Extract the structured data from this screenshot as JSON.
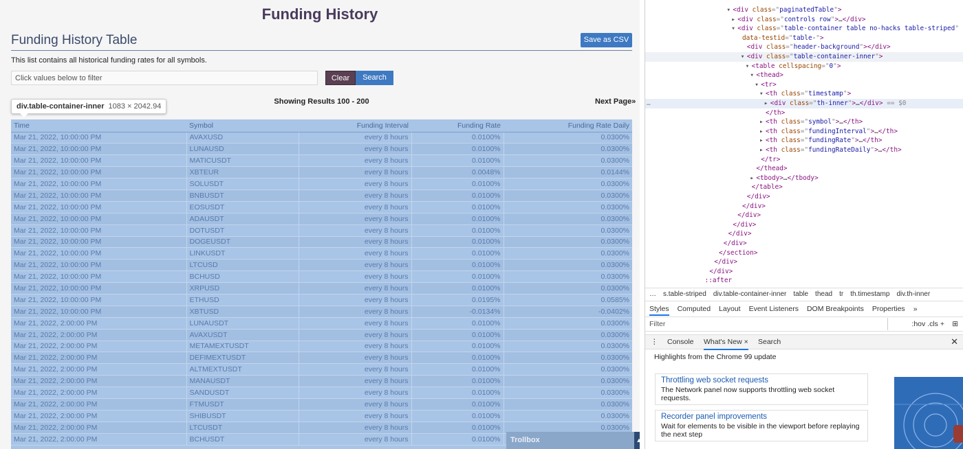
{
  "page": {
    "title": "Funding History",
    "table_heading": "Funding History Table",
    "save_csv": "Save as CSV",
    "description": "This list contains all historical funding rates for all symbols.",
    "filter_placeholder": "Click values below to filter",
    "clear": "Clear",
    "search": "Search",
    "showing": "Showing Results 100 - 200",
    "next_page": "Next Page»",
    "trollbox": "Trollbox"
  },
  "tooltip": {
    "selector": "div.table-container-inner",
    "dims": "1083 × 2042.94"
  },
  "table": {
    "headers": [
      "Time",
      "Symbol",
      "Funding Interval",
      "Funding Rate",
      "Funding Rate Daily"
    ],
    "rows": [
      [
        "Mar 21, 2022, 10:00:00 PM",
        "AVAXUSD",
        "every 8 hours",
        "0.0100%",
        "0.0300%"
      ],
      [
        "Mar 21, 2022, 10:00:00 PM",
        "LUNAUSD",
        "every 8 hours",
        "0.0100%",
        "0.0300%"
      ],
      [
        "Mar 21, 2022, 10:00:00 PM",
        "MATICUSDT",
        "every 8 hours",
        "0.0100%",
        "0.0300%"
      ],
      [
        "Mar 21, 2022, 10:00:00 PM",
        "XBTEUR",
        "every 8 hours",
        "0.0048%",
        "0.0144%"
      ],
      [
        "Mar 21, 2022, 10:00:00 PM",
        "SOLUSDT",
        "every 8 hours",
        "0.0100%",
        "0.0300%"
      ],
      [
        "Mar 21, 2022, 10:00:00 PM",
        "BNBUSDT",
        "every 8 hours",
        "0.0100%",
        "0.0300%"
      ],
      [
        "Mar 21, 2022, 10:00:00 PM",
        "EOSUSDT",
        "every 8 hours",
        "0.0100%",
        "0.0300%"
      ],
      [
        "Mar 21, 2022, 10:00:00 PM",
        "ADAUSDT",
        "every 8 hours",
        "0.0100%",
        "0.0300%"
      ],
      [
        "Mar 21, 2022, 10:00:00 PM",
        "DOTUSDT",
        "every 8 hours",
        "0.0100%",
        "0.0300%"
      ],
      [
        "Mar 21, 2022, 10:00:00 PM",
        "DOGEUSDT",
        "every 8 hours",
        "0.0100%",
        "0.0300%"
      ],
      [
        "Mar 21, 2022, 10:00:00 PM",
        "LINKUSDT",
        "every 8 hours",
        "0.0100%",
        "0.0300%"
      ],
      [
        "Mar 21, 2022, 10:00:00 PM",
        "LTCUSD",
        "every 8 hours",
        "0.0100%",
        "0.0300%"
      ],
      [
        "Mar 21, 2022, 10:00:00 PM",
        "BCHUSD",
        "every 8 hours",
        "0.0100%",
        "0.0300%"
      ],
      [
        "Mar 21, 2022, 10:00:00 PM",
        "XRPUSD",
        "every 8 hours",
        "0.0100%",
        "0.0300%"
      ],
      [
        "Mar 21, 2022, 10:00:00 PM",
        "ETHUSD",
        "every 8 hours",
        "0.0195%",
        "0.0585%"
      ],
      [
        "Mar 21, 2022, 10:00:00 PM",
        "XBTUSD",
        "every 8 hours",
        "-0.0134%",
        "-0.0402%"
      ],
      [
        "Mar 21, 2022, 2:00:00 PM",
        "LUNAUSDT",
        "every 8 hours",
        "0.0100%",
        "0.0300%"
      ],
      [
        "Mar 21, 2022, 2:00:00 PM",
        "AVAXUSDT",
        "every 8 hours",
        "0.0100%",
        "0.0300%"
      ],
      [
        "Mar 21, 2022, 2:00:00 PM",
        "METAMEXTUSDT",
        "every 8 hours",
        "0.0100%",
        "0.0300%"
      ],
      [
        "Mar 21, 2022, 2:00:00 PM",
        "DEFIMEXTUSDT",
        "every 8 hours",
        "0.0100%",
        "0.0300%"
      ],
      [
        "Mar 21, 2022, 2:00:00 PM",
        "ALTMEXTUSDT",
        "every 8 hours",
        "0.0100%",
        "0.0300%"
      ],
      [
        "Mar 21, 2022, 2:00:00 PM",
        "MANAUSDT",
        "every 8 hours",
        "0.0100%",
        "0.0300%"
      ],
      [
        "Mar 21, 2022, 2:00:00 PM",
        "SANDUSDT",
        "every 8 hours",
        "0.0100%",
        "0.0300%"
      ],
      [
        "Mar 21, 2022, 2:00:00 PM",
        "FTMUSDT",
        "every 8 hours",
        "0.0100%",
        "0.0300%"
      ],
      [
        "Mar 21, 2022, 2:00:00 PM",
        "SHIBUSDT",
        "every 8 hours",
        "0.0100%",
        "0.0300%"
      ],
      [
        "Mar 21, 2022, 2:00:00 PM",
        "LTCUSDT",
        "every 8 hours",
        "0.0100%",
        "0.0300%"
      ],
      [
        "Mar 21, 2022, 2:00:00 PM",
        "BCHUSDT",
        "every 8 hours",
        "0.0100%",
        "0.0300%"
      ]
    ]
  },
  "devtools": {
    "dom_lines": [
      {
        "indent": 18,
        "arrow": "▾",
        "parts": [
          [
            "tg",
            "<div "
          ],
          [
            "at",
            "class"
          ],
          [
            "eq",
            "=\""
          ],
          [
            "av",
            "paginatedTable"
          ],
          [
            "eq",
            "\""
          ],
          [
            "tg",
            ">"
          ]
        ]
      },
      {
        "indent": 19,
        "arrow": "▸",
        "parts": [
          [
            "tg",
            "<div "
          ],
          [
            "at",
            "class"
          ],
          [
            "eq",
            "=\""
          ],
          [
            "av",
            "controls row"
          ],
          [
            "eq",
            "\""
          ],
          [
            "tg",
            ">"
          ],
          [
            "tx",
            "…"
          ],
          [
            "tg",
            "</div>"
          ]
        ]
      },
      {
        "indent": 19,
        "arrow": "▾",
        "parts": [
          [
            "tg",
            "<div "
          ],
          [
            "at",
            "class"
          ],
          [
            "eq",
            "=\""
          ],
          [
            "av",
            "table-container table no-hacks table-striped"
          ],
          [
            "eq",
            "\""
          ]
        ]
      },
      {
        "indent": 20,
        "arrow": "",
        "parts": [
          [
            "at",
            "data-testid"
          ],
          [
            "eq",
            "=\""
          ],
          [
            "av",
            "table-"
          ],
          [
            "eq",
            "\""
          ],
          [
            "tg",
            ">"
          ]
        ]
      },
      {
        "indent": 21,
        "arrow": "",
        "parts": [
          [
            "tg",
            "<div "
          ],
          [
            "at",
            "class"
          ],
          [
            "eq",
            "=\""
          ],
          [
            "av",
            "header-background"
          ],
          [
            "eq",
            "\""
          ],
          [
            "tg",
            "></div>"
          ]
        ]
      },
      {
        "indent": 21,
        "arrow": "▾",
        "hov": true,
        "parts": [
          [
            "tg",
            "<div "
          ],
          [
            "at",
            "class"
          ],
          [
            "eq",
            "=\""
          ],
          [
            "av",
            "table-container-inner"
          ],
          [
            "eq",
            "\""
          ],
          [
            "tg",
            ">"
          ]
        ]
      },
      {
        "indent": 22,
        "arrow": "▾",
        "parts": [
          [
            "tg",
            "<table "
          ],
          [
            "at",
            "cellspacing"
          ],
          [
            "eq",
            "=\""
          ],
          [
            "av",
            "0"
          ],
          [
            "eq",
            "\""
          ],
          [
            "tg",
            ">"
          ]
        ]
      },
      {
        "indent": 23,
        "arrow": "▾",
        "parts": [
          [
            "tg",
            "<thead>"
          ]
        ]
      },
      {
        "indent": 24,
        "arrow": "▾",
        "parts": [
          [
            "tg",
            "<tr>"
          ]
        ]
      },
      {
        "indent": 25,
        "arrow": "▾",
        "parts": [
          [
            "tg",
            "<th "
          ],
          [
            "at",
            "class"
          ],
          [
            "eq",
            "=\""
          ],
          [
            "av",
            "timestamp"
          ],
          [
            "eq",
            "\""
          ],
          [
            "tg",
            ">"
          ]
        ]
      },
      {
        "indent": 26,
        "arrow": "▸",
        "sel": true,
        "parts": [
          [
            "tg",
            "<div "
          ],
          [
            "at",
            "class"
          ],
          [
            "eq",
            "=\""
          ],
          [
            "av",
            "th-inner"
          ],
          [
            "eq",
            "\""
          ],
          [
            "tg",
            ">"
          ],
          [
            "tx",
            "…"
          ],
          [
            "tg",
            "</div>"
          ],
          [
            "eq",
            " == $0"
          ]
        ]
      },
      {
        "indent": 25,
        "arrow": "",
        "parts": [
          [
            "tg",
            "</th>"
          ]
        ]
      },
      {
        "indent": 25,
        "arrow": "▸",
        "parts": [
          [
            "tg",
            "<th "
          ],
          [
            "at",
            "class"
          ],
          [
            "eq",
            "=\""
          ],
          [
            "av",
            "symbol"
          ],
          [
            "eq",
            "\""
          ],
          [
            "tg",
            ">"
          ],
          [
            "tx",
            "…"
          ],
          [
            "tg",
            "</th>"
          ]
        ]
      },
      {
        "indent": 25,
        "arrow": "▸",
        "parts": [
          [
            "tg",
            "<th "
          ],
          [
            "at",
            "class"
          ],
          [
            "eq",
            "=\""
          ],
          [
            "av",
            "fundingInterval"
          ],
          [
            "eq",
            "\""
          ],
          [
            "tg",
            ">"
          ],
          [
            "tx",
            "…"
          ],
          [
            "tg",
            "</th>"
          ]
        ]
      },
      {
        "indent": 25,
        "arrow": "▸",
        "parts": [
          [
            "tg",
            "<th "
          ],
          [
            "at",
            "class"
          ],
          [
            "eq",
            "=\""
          ],
          [
            "av",
            "fundingRate"
          ],
          [
            "eq",
            "\""
          ],
          [
            "tg",
            ">"
          ],
          [
            "tx",
            "…"
          ],
          [
            "tg",
            "</th>"
          ]
        ]
      },
      {
        "indent": 25,
        "arrow": "▸",
        "parts": [
          [
            "tg",
            "<th "
          ],
          [
            "at",
            "class"
          ],
          [
            "eq",
            "=\""
          ],
          [
            "av",
            "fundingRateDaily"
          ],
          [
            "eq",
            "\""
          ],
          [
            "tg",
            ">"
          ],
          [
            "tx",
            "…"
          ],
          [
            "tg",
            "</th>"
          ]
        ]
      },
      {
        "indent": 24,
        "arrow": "",
        "parts": [
          [
            "tg",
            "</tr>"
          ]
        ]
      },
      {
        "indent": 23,
        "arrow": "",
        "parts": [
          [
            "tg",
            "</thead>"
          ]
        ]
      },
      {
        "indent": 23,
        "arrow": "▸",
        "parts": [
          [
            "tg",
            "<tbody>"
          ],
          [
            "tx",
            "…"
          ],
          [
            "tg",
            "</tbody>"
          ]
        ]
      },
      {
        "indent": 22,
        "arrow": "",
        "parts": [
          [
            "tg",
            "</table>"
          ]
        ]
      },
      {
        "indent": 21,
        "arrow": "",
        "parts": [
          [
            "tg",
            "</div>"
          ]
        ]
      },
      {
        "indent": 20,
        "arrow": "",
        "parts": [
          [
            "tg",
            "</div>"
          ]
        ]
      },
      {
        "indent": 19,
        "arrow": "",
        "parts": [
          [
            "tg",
            "</div>"
          ]
        ]
      },
      {
        "indent": 18,
        "arrow": "",
        "parts": [
          [
            "tg",
            "</div>"
          ]
        ]
      },
      {
        "indent": 17,
        "arrow": "",
        "parts": [
          [
            "tg",
            "</div>"
          ]
        ]
      },
      {
        "indent": 16,
        "arrow": "",
        "parts": [
          [
            "tg",
            "</div>"
          ]
        ]
      },
      {
        "indent": 15,
        "arrow": "",
        "parts": [
          [
            "tg",
            "</section>"
          ]
        ]
      },
      {
        "indent": 14,
        "arrow": "",
        "parts": [
          [
            "tg",
            "</div>"
          ]
        ]
      },
      {
        "indent": 13,
        "arrow": "",
        "parts": [
          [
            "tg",
            "</div>"
          ]
        ]
      },
      {
        "indent": 12,
        "arrow": "",
        "parts": [
          [
            "tg",
            "::after"
          ]
        ]
      }
    ],
    "breadcrumbs": [
      "…",
      "s.table-striped",
      "div.table-container-inner",
      "table",
      "thead",
      "tr",
      "th.timestamp",
      "div.th-inner"
    ],
    "style_tabs": [
      "Styles",
      "Computed",
      "Layout",
      "Event Listeners",
      "DOM Breakpoints",
      "Properties",
      "»"
    ],
    "filter_placeholder": "Filter",
    "filter_tools": ":hov  .cls  +",
    "drawer_tabs": [
      "Console",
      "What's New ×",
      "Search"
    ],
    "highlights": "Highlights from the Chrome 99 update",
    "cards": [
      {
        "title": "Throttling web socket requests",
        "body": "The Network panel now supports throttling web socket requests."
      },
      {
        "title": "Recorder panel improvements",
        "body": "Wait for elements to be visible in the viewport before replaying the next step"
      }
    ]
  }
}
